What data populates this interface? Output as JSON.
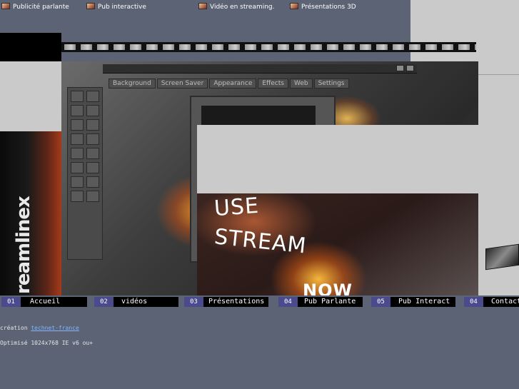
{
  "top_nav": [
    {
      "label": "Publicité parlante",
      "icon": "film-frame-icon"
    },
    {
      "label": "Pub  interactive",
      "icon": "film-frame-icon"
    },
    {
      "label": "Vidéo en streaming.",
      "icon": "film-frame-icon"
    },
    {
      "label": "Présentations 3D",
      "icon": "film-frame-icon"
    }
  ],
  "screen_tabs": [
    "Background",
    "Screen Saver",
    "Appearance",
    "Effects",
    "Web",
    "Settings"
  ],
  "hero_text": {
    "line1": "USE",
    "line2": "STREAM",
    "line3": "NOW"
  },
  "logo_text": "reamlinex",
  "bottom_nav": [
    {
      "num": "01",
      "label": "Accueil"
    },
    {
      "num": "02",
      "label": "vidéos"
    },
    {
      "num": "03",
      "label": "Présentations"
    },
    {
      "num": "04",
      "label": "Pub Parlante"
    },
    {
      "num": "05",
      "label": "Pub Interact"
    },
    {
      "num": "04",
      "label": "Contact"
    }
  ],
  "footer": {
    "credit_prefix": "création",
    "credit_link": "technet-france",
    "optimized": "Optimisé 1024x768 IE v6 ou+"
  },
  "colors": {
    "background": "#5c6375",
    "panel_grey": "#cacaca",
    "nav_number_bg": "#4a4a8c",
    "link": "#7fb6ff"
  }
}
